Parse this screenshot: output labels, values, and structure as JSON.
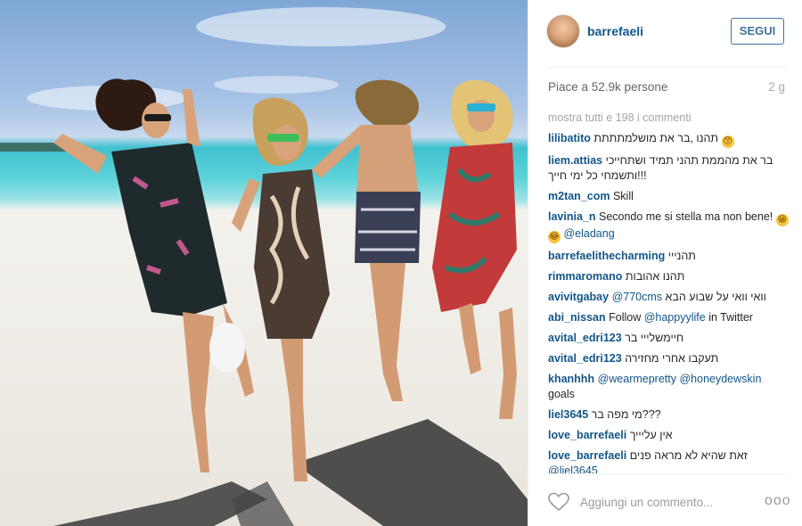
{
  "header": {
    "username": "barrefaeli",
    "follow_label": "SEGUI"
  },
  "post": {
    "likes": "Piace a 52.9k persone",
    "age": "2 g"
  },
  "comments": {
    "view_all": "mostra tutti e 198 i commenti",
    "items": [
      {
        "user": "lilibatito",
        "text": "תהנו ,בר את מושלמתתתת",
        "emoji": "😙"
      },
      {
        "user": "liem.attias",
        "text": "בר את מהממת תהני תמיד ושתחייכי ותשמחי כל ימי חייך!!!"
      },
      {
        "user": "m2tan_com",
        "text": "Skill"
      },
      {
        "user": "lavinia_n",
        "text": "Secondo me si stella ma non bene!",
        "emoji": "😁😂",
        "mention": "@eladang"
      },
      {
        "user": "barrefaelithecharming",
        "text": "תהנייי"
      },
      {
        "user": "rimmaromano",
        "text": "תהנו אהובות"
      },
      {
        "user": "avivitgabay",
        "mention": "@770cms",
        "text": "וואי וואי על שבוע הבא"
      },
      {
        "user": "abi_nissan",
        "text": "Follow",
        "mention": "@happyylife",
        "text2": "in Twitter"
      },
      {
        "user": "avital_edri123",
        "text": "חיימשלייי בר"
      },
      {
        "user": "avital_edri123",
        "text": "תעקבו אחרי מחזירה"
      },
      {
        "user": "khanhhh",
        "mention": "@wearmepretty",
        "mention2": "@honeydewskin",
        "text": "goals"
      },
      {
        "user": "liel3645",
        "text": "מי מפה בר???"
      },
      {
        "user": "love_barrefaeli",
        "text": "אין עליייך"
      },
      {
        "user": "love_barrefaeli",
        "text": "זאת שהיא לא מראה פנים",
        "mention": "@liel3645"
      }
    ]
  },
  "footer": {
    "comment_placeholder": "Aggiungi un commento...",
    "more_label": "ooo"
  },
  "icons": {
    "like": "heart-icon",
    "more": "more-options-icon"
  },
  "colors": {
    "username_blue": "#125688",
    "follow_blue": "#3f729b",
    "muted": "#a5a5a5"
  }
}
